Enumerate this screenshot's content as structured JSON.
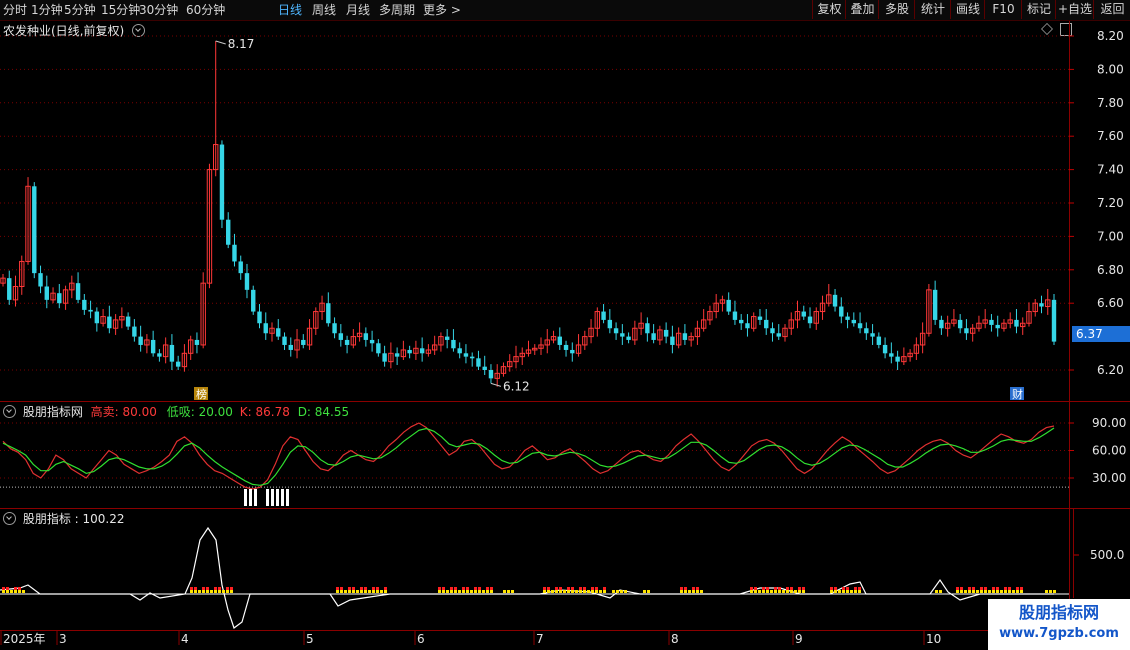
{
  "toolbar": {
    "periods": [
      {
        "label": "分时"
      },
      {
        "label": "1分钟"
      },
      {
        "label": "5分钟"
      },
      {
        "label": "15分钟"
      },
      {
        "label": "30分钟"
      },
      {
        "label": "60分钟"
      },
      {
        "label": "日线",
        "active": true
      },
      {
        "label": "周线"
      },
      {
        "label": "月线"
      },
      {
        "label": "多周期"
      },
      {
        "label": "更多 >"
      }
    ],
    "actions": [
      {
        "label": "复权"
      },
      {
        "label": "叠加"
      },
      {
        "label": "多股"
      },
      {
        "label": "统计"
      },
      {
        "label": "画线"
      },
      {
        "label": "F10"
      },
      {
        "label": "标记"
      },
      {
        "label": "+自选"
      },
      {
        "label": "返回"
      }
    ]
  },
  "main_chart": {
    "title": "农发种业(日线,前复权)",
    "high_label": "8.17",
    "low_label": "6.12",
    "current_price": "6.37",
    "badge_bang": "榜",
    "badge_cai": "财",
    "y_ticks": [
      "8.20",
      "8.00",
      "7.80",
      "7.60",
      "7.40",
      "7.20",
      "7.00",
      "6.80",
      "6.60",
      "6.20"
    ]
  },
  "kdj_panel": {
    "title": "股朋指标网",
    "sell_label": "高卖: 80.00",
    "buy_label": "低吸: 20.00",
    "k_label": "K: 86.78",
    "d_label": "D: 84.55",
    "y_ticks": [
      "90.00",
      "60.00",
      "30.00"
    ]
  },
  "ind_panel": {
    "title": "股朋指标 : 100.22",
    "y_ticks": [
      "500.0"
    ]
  },
  "x_axis": {
    "labels": [
      "2025年",
      "3",
      "4",
      "5",
      "6",
      "7",
      "8",
      "9",
      "10"
    ]
  },
  "watermark": {
    "line1": "股朋指标网",
    "line2": "www.7gpzb.com"
  },
  "colors": {
    "up": "#ff3838",
    "down": "#36d6e7",
    "grid": "#7a0000",
    "k_line": "#e03030",
    "d_line": "#30e030",
    "bar_red": "#ff2020",
    "bar_yellow": "#ffe400",
    "accent_blue": "#4fb6ff"
  },
  "chart_data": [
    {
      "type": "candlestick",
      "title": "农发种业(日线,前复权)",
      "ylim": [
        6.1,
        8.25
      ],
      "annotations": [
        {
          "text": "8.17",
          "value": 8.17
        },
        {
          "text": "6.12",
          "value": 6.12
        }
      ],
      "last_price": 6.37,
      "closes": [
        6.75,
        6.62,
        6.7,
        6.85,
        7.3,
        6.78,
        6.7,
        6.62,
        6.66,
        6.6,
        6.68,
        6.72,
        6.62,
        6.56,
        6.55,
        6.48,
        6.52,
        6.45,
        6.5,
        6.52,
        6.46,
        6.4,
        6.35,
        6.38,
        6.3,
        6.28,
        6.35,
        6.25,
        6.22,
        6.3,
        6.38,
        6.35,
        6.72,
        7.4,
        7.55,
        7.1,
        6.95,
        6.85,
        6.78,
        6.68,
        6.55,
        6.48,
        6.42,
        6.45,
        6.4,
        6.35,
        6.32,
        6.38,
        6.35,
        6.45,
        6.55,
        6.6,
        6.48,
        6.42,
        6.38,
        6.35,
        6.4,
        6.42,
        6.38,
        6.36,
        6.3,
        6.25,
        6.3,
        6.28,
        6.32,
        6.3,
        6.33,
        6.3,
        6.32,
        6.35,
        6.4,
        6.38,
        6.33,
        6.3,
        6.28,
        6.27,
        6.22,
        6.2,
        6.15,
        6.18,
        6.22,
        6.25,
        6.28,
        6.3,
        6.32,
        6.33,
        6.35,
        6.38,
        6.4,
        6.35,
        6.32,
        6.3,
        6.35,
        6.4,
        6.45,
        6.55,
        6.5,
        6.45,
        6.42,
        6.4,
        6.38,
        6.45,
        6.48,
        6.42,
        6.38,
        6.44,
        6.4,
        6.35,
        6.42,
        6.38,
        6.4,
        6.45,
        6.5,
        6.55,
        6.6,
        6.62,
        6.55,
        6.5,
        6.48,
        6.45,
        6.52,
        6.5,
        6.45,
        6.42,
        6.4,
        6.45,
        6.5,
        6.55,
        6.52,
        6.48,
        6.55,
        6.6,
        6.65,
        6.58,
        6.52,
        6.5,
        6.48,
        6.45,
        6.42,
        6.4,
        6.35,
        6.3,
        6.28,
        6.25,
        6.28,
        6.3,
        6.35,
        6.42,
        6.68,
        6.5,
        6.45,
        6.48,
        6.5,
        6.45,
        6.42,
        6.45,
        6.48,
        6.5,
        6.47,
        6.45,
        6.48,
        6.5,
        6.46,
        6.48,
        6.55,
        6.6,
        6.58,
        6.62,
        6.37
      ]
    },
    {
      "type": "line",
      "title": "股朋指标网",
      "ylim": [
        15,
        95
      ],
      "thresholds": {
        "高卖": 80.0,
        "低吸": 20.0
      },
      "series": [
        {
          "name": "K",
          "last": 86.78,
          "values": [
            70,
            62,
            58,
            50,
            35,
            30,
            40,
            55,
            50,
            40,
            35,
            30,
            40,
            50,
            60,
            55,
            45,
            40,
            35,
            38,
            42,
            48,
            55,
            70,
            75,
            68,
            55,
            45,
            38,
            35,
            30,
            25,
            20,
            18,
            20,
            28,
            45,
            65,
            75,
            72,
            60,
            48,
            40,
            38,
            45,
            55,
            60,
            55,
            50,
            48,
            55,
            65,
            72,
            80,
            86,
            90,
            85,
            75,
            65,
            55,
            60,
            70,
            72,
            65,
            55,
            45,
            40,
            42,
            50,
            60,
            65,
            58,
            50,
            52,
            58,
            62,
            55,
            48,
            40,
            35,
            38,
            45,
            52,
            58,
            60,
            55,
            50,
            48,
            55,
            65,
            72,
            78,
            70,
            60,
            50,
            42,
            38,
            45,
            55,
            65,
            70,
            72,
            68,
            60,
            50,
            40,
            35,
            40,
            50,
            60,
            68,
            75,
            70,
            62,
            55,
            48,
            40,
            35,
            38,
            45,
            52,
            60,
            66,
            70,
            72,
            68,
            60,
            55,
            52,
            58,
            65,
            72,
            78,
            75,
            70,
            68,
            72,
            80,
            85,
            86.78
          ]
        },
        {
          "name": "D",
          "last": 84.55,
          "values": [
            68,
            64,
            60,
            55,
            45,
            38,
            38,
            45,
            48,
            44,
            40,
            35,
            37,
            43,
            50,
            52,
            50,
            46,
            42,
            40,
            40,
            43,
            48,
            56,
            65,
            68,
            63,
            55,
            48,
            42,
            37,
            32,
            27,
            23,
            22,
            24,
            33,
            45,
            58,
            65,
            64,
            58,
            50,
            45,
            44,
            48,
            53,
            55,
            53,
            51,
            52,
            57,
            63,
            70,
            76,
            82,
            84,
            81,
            75,
            67,
            64,
            66,
            68,
            67,
            62,
            55,
            49,
            46,
            47,
            52,
            57,
            58,
            55,
            54,
            56,
            58,
            57,
            54,
            49,
            44,
            42,
            43,
            46,
            50,
            54,
            55,
            53,
            51,
            52,
            57,
            63,
            69,
            69,
            66,
            60,
            53,
            47,
            46,
            49,
            55,
            61,
            65,
            66,
            64,
            59,
            52,
            46,
            44,
            46,
            51,
            57,
            63,
            66,
            65,
            61,
            56,
            51,
            45,
            42,
            42,
            46,
            51,
            57,
            62,
            66,
            67,
            65,
            62,
            58,
            58,
            61,
            65,
            70,
            72,
            71,
            70,
            70,
            74,
            79,
            84.55
          ]
        }
      ],
      "y_ticks": [
        90,
        60,
        30
      ]
    },
    {
      "type": "line",
      "title": "股朋指标",
      "last": 100.22,
      "y_ticks": [
        500.0
      ]
    }
  ]
}
